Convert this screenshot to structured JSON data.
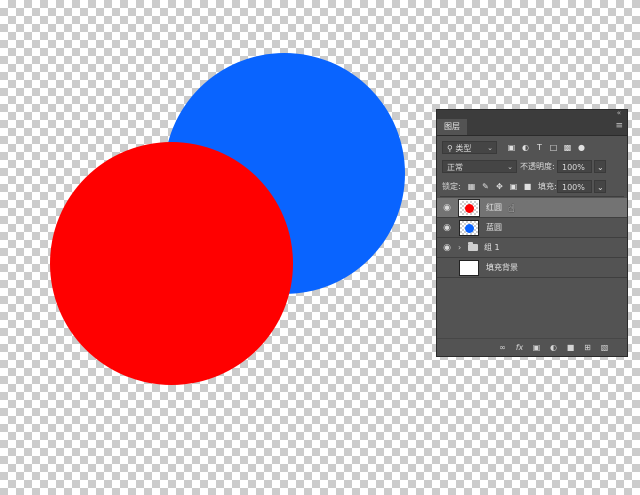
{
  "colors": {
    "blue_circle": "#0964ff",
    "red_circle": "#ff0000",
    "panel_bg": "#535353",
    "selected_row": "#737373"
  },
  "panel": {
    "title": "图层",
    "collapse_icon": "double-chevron-left-icon",
    "menu_icon": "hamburger-menu-icon",
    "filter": {
      "kind_label": "类型",
      "buttons": [
        "pixel-filter-icon",
        "adjustment-filter-icon",
        "type-filter-icon",
        "shape-filter-icon",
        "smart-object-filter-icon",
        "filter-toggle-icon"
      ]
    },
    "blend_mode": "正常",
    "opacity_label": "不透明度:",
    "opacity_value": "100%",
    "lock_label": "锁定:",
    "fill_label": "填充:",
    "fill_value": "100%",
    "lock_buttons": [
      "lock-transparent-icon",
      "lock-image-icon",
      "lock-position-icon",
      "lock-artboard-icon",
      "lock-all-icon"
    ]
  },
  "layers": [
    {
      "name": "红圆",
      "visible": true,
      "selected": true,
      "thumb_color": "#ff0000"
    },
    {
      "name": "蓝圆",
      "visible": true,
      "selected": false,
      "thumb_color": "#0964ff"
    },
    {
      "name": "组 1",
      "visible": true,
      "selected": false,
      "type": "group"
    },
    {
      "name": "填充背景",
      "visible": false,
      "selected": false,
      "thumb_color": "#ffffff"
    }
  ],
  "bottom_buttons": [
    "link-layers-icon",
    "fx-icon",
    "add-mask-icon",
    "adjustment-layer-icon",
    "new-group-icon",
    "new-layer-icon",
    "delete-layer-icon"
  ]
}
